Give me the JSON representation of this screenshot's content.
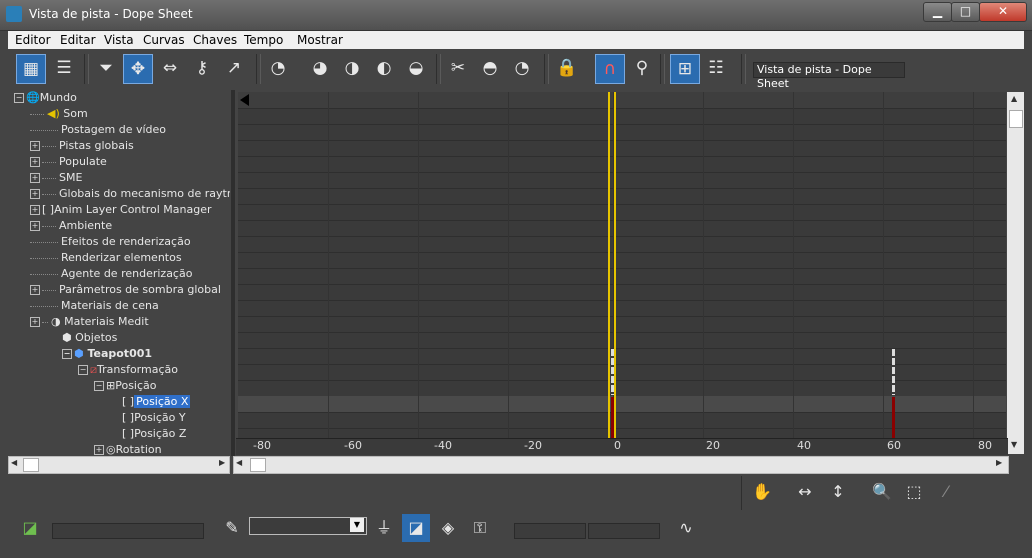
{
  "window": {
    "title": "Vista de pista - Dope Sheet"
  },
  "menu": [
    "Editor",
    "Editar",
    "Vista",
    "Curvas",
    "Chaves",
    "Tempo",
    "Mostrar"
  ],
  "toolbar": {
    "name_field": "Vista de pista - Dope Sheet"
  },
  "tree": {
    "items": [
      {
        "label": "Mundo",
        "icon": "globe-icon"
      },
      {
        "label": "Som",
        "icon": "speaker-icon"
      },
      {
        "label": "Postagem de vídeo"
      },
      {
        "label": "Pistas globais"
      },
      {
        "label": "Populate"
      },
      {
        "label": "SME"
      },
      {
        "label": "Globais do mecanismo de raytracing"
      },
      {
        "label": "Anim Layer Control Manager"
      },
      {
        "label": "Ambiente"
      },
      {
        "label": "Efeitos de renderização"
      },
      {
        "label": "Renderizar elementos"
      },
      {
        "label": "Agente de renderização"
      },
      {
        "label": "Parâmetros de sombra global"
      },
      {
        "label": "Materiais de cena"
      },
      {
        "label": "Materiais Medit"
      },
      {
        "label": "Objetos"
      },
      {
        "label": "Teapot001"
      },
      {
        "label": "Transformação"
      },
      {
        "label": "Posição"
      },
      {
        "label": "Posição X"
      },
      {
        "label": "Posição Y"
      },
      {
        "label": "Posição Z"
      },
      {
        "label": "Rotation"
      }
    ]
  },
  "ruler": {
    "ticks": [
      "-80",
      "-60",
      "-40",
      "-20",
      "0",
      "20",
      "40",
      "60",
      "80"
    ]
  },
  "colors": {
    "time_slider": "#e6c400",
    "key_red": "#8b0000",
    "selection": "#2f6fc9"
  }
}
